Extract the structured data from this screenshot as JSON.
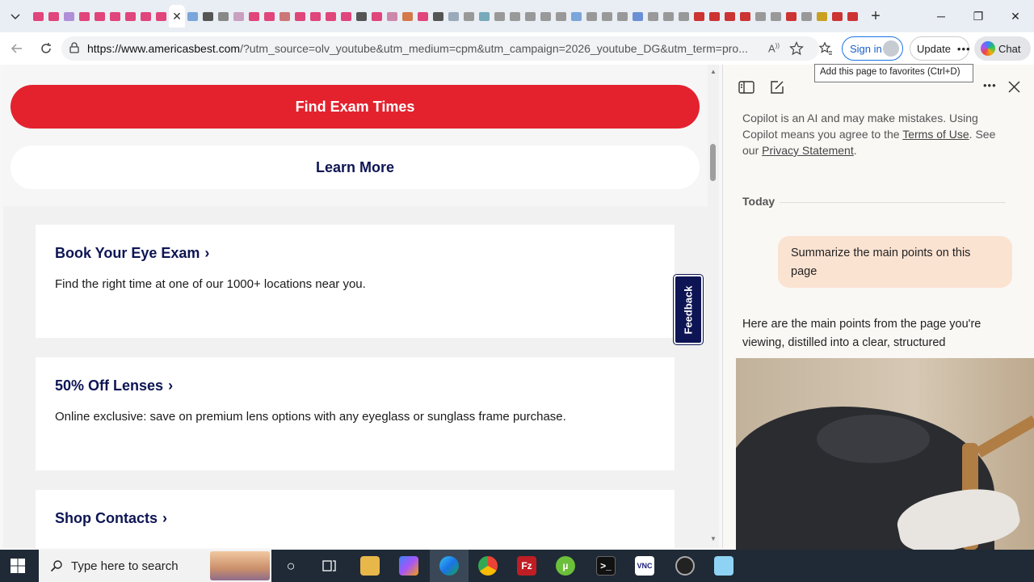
{
  "browser": {
    "url_host": "https://www.americasbest.com",
    "url_rest": "/?utm_source=olv_youtube&utm_medium=cpm&utm_campaign=2026_youtube_DG&utm_term=pro...",
    "tooltip": "Add this page to favorites (Ctrl+D)",
    "signin_label": "Sign in",
    "update_label": "Update",
    "chat_label": "Chat",
    "active_tab_close": "✕",
    "new_tab": "+"
  },
  "page": {
    "find_exam_button": "Find Exam Times",
    "learn_more_button": "Learn More",
    "feedback_tab": "Feedback",
    "cards": [
      {
        "title": "Book Your Eye Exam",
        "desc": "Find the right time at one of our 1000+ locations near you."
      },
      {
        "title": "50% Off Lenses",
        "desc": "Online exclusive: save on premium lens options with any eyeglass or sunglass frame purchase."
      },
      {
        "title": "Shop Contacts",
        "desc": ""
      }
    ]
  },
  "copilot": {
    "disclaimer_prefix": "Copilot is an AI and may make mistakes. Using Copilot means you agree to the ",
    "terms_link": "Terms of Use",
    "disclaimer_mid": ". See our ",
    "privacy_link": "Privacy Statement",
    "disclaimer_suffix": ".",
    "today_label": "Today",
    "user_message": "Summarize the main points on this page",
    "reply_text": "Here are the main points from the page you're viewing, distilled into a clear, structured"
  },
  "taskbar": {
    "search_placeholder": "Type here to search"
  },
  "colors": {
    "brand_red": "#e3222e",
    "brand_navy": "#0d1554",
    "copilot_bubble": "#fbe3d2"
  }
}
